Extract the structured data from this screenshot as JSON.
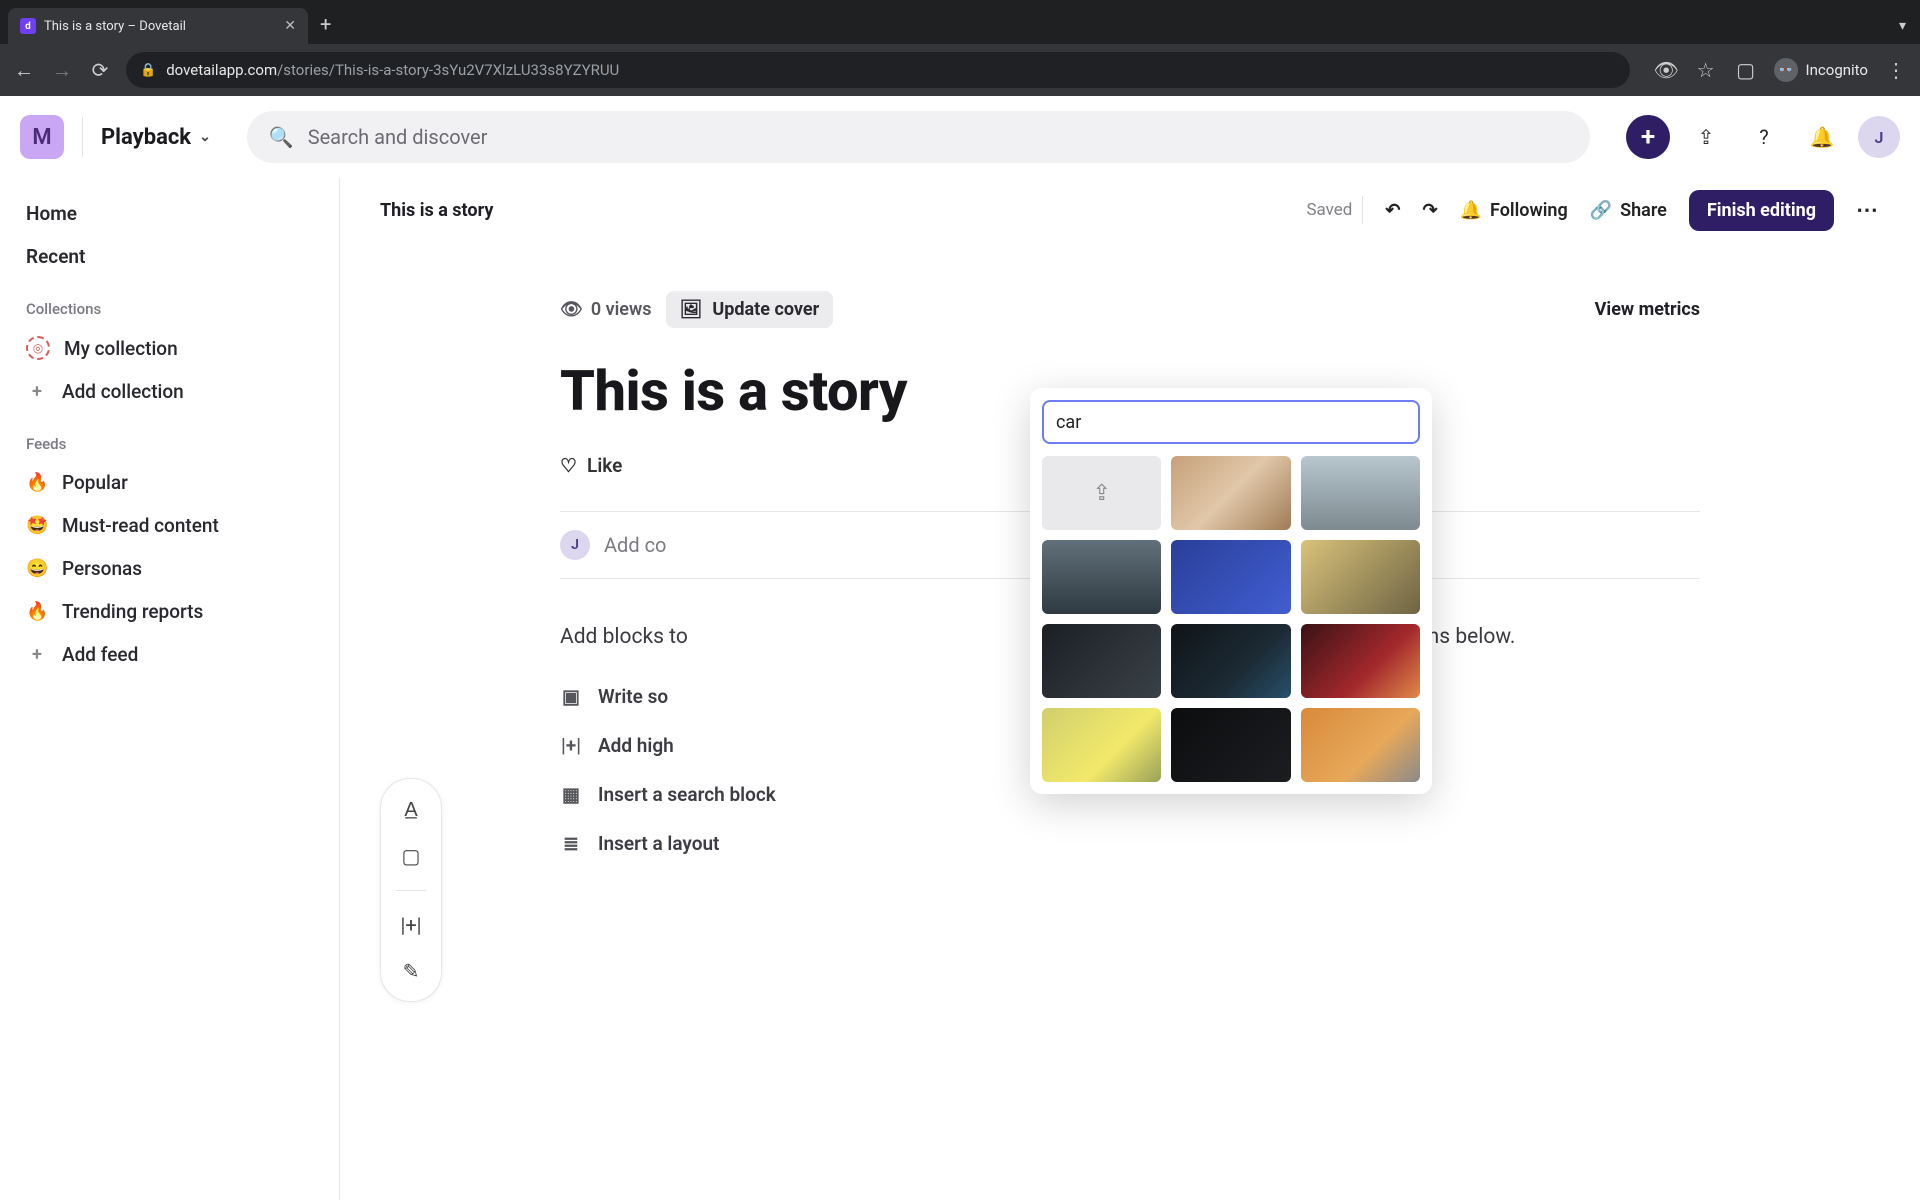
{
  "browser": {
    "tab_title": "This is a story – Dovetail",
    "url_host": "dovetailapp.com",
    "url_path": "/stories/This-is-a-story-3sYu2V7XlzLU33s8YZYRUU",
    "incognito_label": "Incognito"
  },
  "header": {
    "workspace_initial": "M",
    "workspace_name": "Playback",
    "search_placeholder": "Search and discover",
    "user_initial": "J"
  },
  "sidebar": {
    "home": "Home",
    "recent": "Recent",
    "collections_label": "Collections",
    "collections": [
      {
        "label": "My collection"
      }
    ],
    "add_collection": "Add collection",
    "feeds_label": "Feeds",
    "feeds": [
      {
        "icon": "🔥",
        "label": "Popular"
      },
      {
        "icon": "🤩",
        "label": "Must-read content"
      },
      {
        "icon": "😄",
        "label": "Personas"
      },
      {
        "icon": "🔥",
        "label": "Trending reports"
      }
    ],
    "add_feed": "Add feed"
  },
  "doc_header": {
    "title": "This is a story",
    "saved": "Saved",
    "following": "Following",
    "share": "Share",
    "finish": "Finish editing"
  },
  "meta": {
    "views": "0 views",
    "update_cover": "Update cover",
    "view_metrics": "View metrics"
  },
  "title": "This is a story",
  "like_label": "Like",
  "comment_placeholder": "Add comment",
  "comment_visible": "Add co",
  "helper_full": "Add blocks to get started by typing \"/\", clicking \"+\" to the left, or choose one of the options below.",
  "helper_visible_left": "Add blocks to",
  "helper_visible_right": "the left, or choose one of the options below.",
  "block_options": {
    "write": "Write something",
    "write_visible": "Write so",
    "highlight": "Add highlight reel",
    "highlight_visible": "Add high",
    "search_block": "Insert a search block",
    "layout": "Insert a layout"
  },
  "cover_popover": {
    "search_value": "car",
    "images": [
      "upload",
      "car-a",
      "car-b",
      "car-c",
      "car-d",
      "car-e",
      "car-f",
      "car-g",
      "car-h",
      "car-i",
      "car-j",
      "car-k"
    ]
  }
}
